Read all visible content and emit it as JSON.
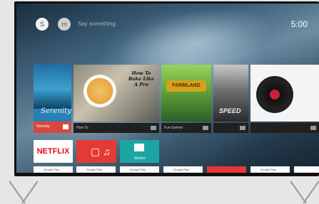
{
  "topbar": {
    "search_glyph": "S",
    "mic_glyph": "m",
    "search_hint": "Say something",
    "clock": "5:00"
  },
  "recommendations": [
    {
      "title": "Serenity",
      "footer": "Serenity",
      "accent": "#d9473c"
    },
    {
      "title": "How To Bake Like A Pro",
      "footer": "How To"
    },
    {
      "title": "FARMLAND",
      "footer": "Fun Games"
    },
    {
      "title": "SPEED",
      "footer": ""
    },
    {
      "title": "",
      "footer": ""
    }
  ],
  "apps": [
    {
      "label": "NETFLIX",
      "color": "#e53935"
    },
    {
      "label": "",
      "glyph": "▢ ♫"
    },
    {
      "label": "Movies",
      "color": "#1ca5a3"
    }
  ],
  "store_tiles": [
    {
      "label": "Google Play"
    },
    {
      "label": "Google Play"
    },
    {
      "label": "Google Play"
    },
    {
      "label": "Google Play"
    },
    {
      "label": "",
      "color": "#e53935"
    },
    {
      "label": "Google Play"
    },
    {
      "label": ""
    }
  ]
}
